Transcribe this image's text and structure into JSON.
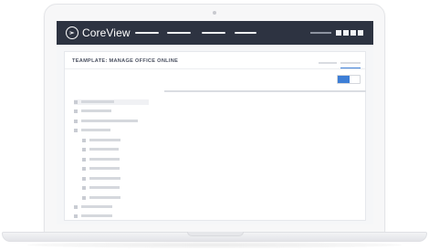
{
  "app": {
    "brand": "CoreView",
    "logo_icon": "coreview-logo-icon"
  },
  "header": {
    "nav_items": 4,
    "toolbar_buttons": 4
  },
  "template": {
    "title": "TEAMPLATE: MANAGE OFFICE ONLINE",
    "active_tab_index": 1,
    "toggle_on": true
  },
  "tree": {
    "items": [
      {
        "level": 0,
        "selected": true
      },
      {
        "level": 0,
        "selected": false
      },
      {
        "level": 0,
        "selected": false
      },
      {
        "level": 0,
        "selected": false
      },
      {
        "level": 1,
        "selected": false
      },
      {
        "level": 1,
        "selected": false
      },
      {
        "level": 1,
        "selected": false
      },
      {
        "level": 1,
        "selected": false
      },
      {
        "level": 1,
        "selected": false
      },
      {
        "level": 1,
        "selected": false
      },
      {
        "level": 1,
        "selected": false
      },
      {
        "level": 0,
        "selected": false
      },
      {
        "level": 0,
        "selected": false
      }
    ]
  },
  "colors": {
    "topbar": "#2d3341",
    "accent": "#3d7ed6",
    "placeholder": "#d5d8dd"
  }
}
